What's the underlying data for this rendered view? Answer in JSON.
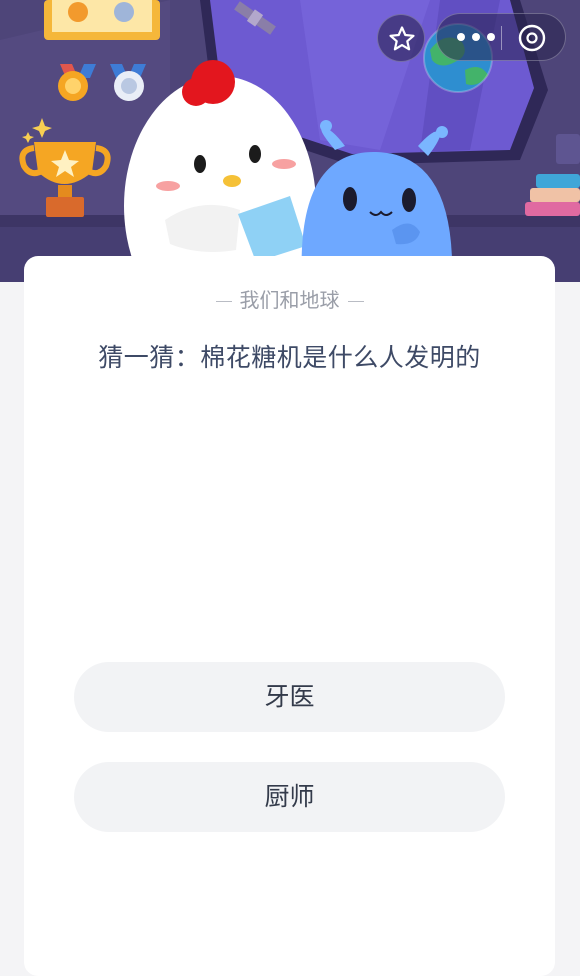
{
  "header": {
    "icons": [
      "medal-icon",
      "trophy-icon",
      "globe-icon",
      "rocket-satellite-icon",
      "books-icon"
    ],
    "characters": [
      "chicken-mascot",
      "blue-alien-mascot"
    ]
  },
  "toolbar": {
    "favorite_icon": "star-icon",
    "more_icon": "more-dots-icon",
    "close_icon": "close-circle-icon"
  },
  "quiz": {
    "category": "我们和地球",
    "question": "猜一猜：棉花糖机是什么人发明的",
    "options": [
      {
        "label": "牙医"
      },
      {
        "label": "厨师"
      }
    ]
  },
  "colors": {
    "hero_bg": "#52487e",
    "window": "#6a56c8",
    "card": "#ffffff",
    "page_bg": "#f4f4f6",
    "option_bg": "#f2f3f5",
    "question_text": "#3e4a66"
  }
}
